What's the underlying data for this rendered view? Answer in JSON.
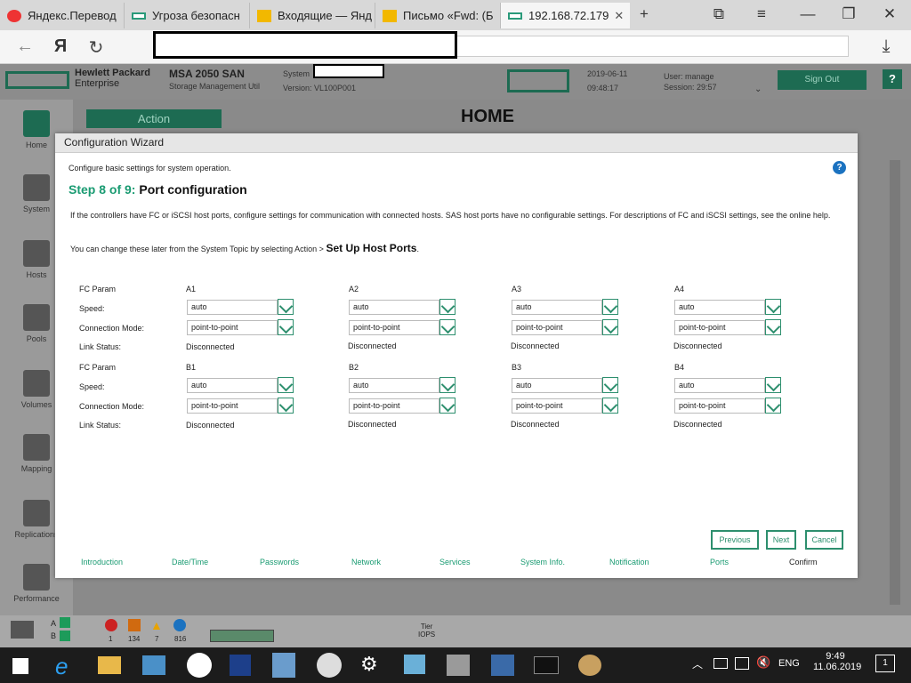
{
  "browser": {
    "tabs": [
      {
        "title": "Яндекс.Перевод"
      },
      {
        "title": "Угроза безопасн"
      },
      {
        "title": "Входящие — Янд"
      },
      {
        "title": "Письмо «Fwd: (Б"
      },
      {
        "title": "192.168.72.179"
      }
    ],
    "yandex_logo": "Я"
  },
  "app": {
    "brand_line1": "Hewlett Packard",
    "brand_line2": "Enterprise",
    "product": "MSA 2050 SAN",
    "product_sub": "Storage Management Util",
    "system_label": "System",
    "version": "Version: VL100P001",
    "date": "2019-06-11",
    "time": "09:48:17",
    "user": "User: manage",
    "session": "Session: 29:57",
    "sign_out": "Sign Out",
    "help": "?",
    "action": "Action",
    "page_title": "HOME"
  },
  "sidebar": {
    "items": [
      {
        "label": "Home"
      },
      {
        "label": "System"
      },
      {
        "label": "Hosts"
      },
      {
        "label": "Pools"
      },
      {
        "label": "Volumes"
      },
      {
        "label": "Mapping"
      },
      {
        "label": "Replications"
      },
      {
        "label": "Performance"
      }
    ]
  },
  "wizard": {
    "title": "Configuration Wizard",
    "intro": "Configure basic settings for system operation.",
    "step_prefix": "Step 8 of 9:",
    "step_title": "Port configuration",
    "description": "If the controllers have FC or iSCSI host ports, configure settings for communication with connected hosts. SAS host ports have no configurable settings. For descriptions of FC and iSCSI settings, see the online help.",
    "later_text": "You can change these later from the System Topic by selecting Action >",
    "later_link": "Set Up Host Ports",
    "later_dot": ".",
    "labels": {
      "fc_param": "FC Param",
      "speed": "Speed:",
      "connection_mode": "Connection Mode:",
      "link_status": "Link Status:"
    },
    "rowA": [
      {
        "port": "A1",
        "speed": "auto",
        "mode": "point-to-point",
        "status": "Disconnected"
      },
      {
        "port": "A2",
        "speed": "auto",
        "mode": "point-to-point",
        "status": "Disconnected"
      },
      {
        "port": "A3",
        "speed": "auto",
        "mode": "point-to-point",
        "status": "Disconnected"
      },
      {
        "port": "A4",
        "speed": "auto",
        "mode": "point-to-point",
        "status": "Disconnected"
      }
    ],
    "rowB": [
      {
        "port": "B1",
        "speed": "auto",
        "mode": "point-to-point",
        "status": "Disconnected"
      },
      {
        "port": "B2",
        "speed": "auto",
        "mode": "point-to-point",
        "status": "Disconnected"
      },
      {
        "port": "B3",
        "speed": "auto",
        "mode": "point-to-point",
        "status": "Disconnected"
      },
      {
        "port": "B4",
        "speed": "auto",
        "mode": "point-to-point",
        "status": "Disconnected"
      }
    ],
    "buttons": {
      "previous": "Previous",
      "next": "Next",
      "cancel": "Cancel"
    },
    "steps": [
      "Introduction",
      "Date/Time",
      "Passwords",
      "Network",
      "Services",
      "System Info.",
      "Notification",
      "Ports",
      "Confirm"
    ],
    "help_icon": "?"
  },
  "status": {
    "ctrl_a": "A",
    "ctrl_b": "B",
    "counts": [
      "1",
      "134",
      "7",
      "816"
    ],
    "tier": "Tier",
    "iops": "IOPS"
  },
  "taskbar": {
    "lang": "ENG",
    "time": "9:49",
    "date": "11.06.2019",
    "notifications": "1"
  }
}
